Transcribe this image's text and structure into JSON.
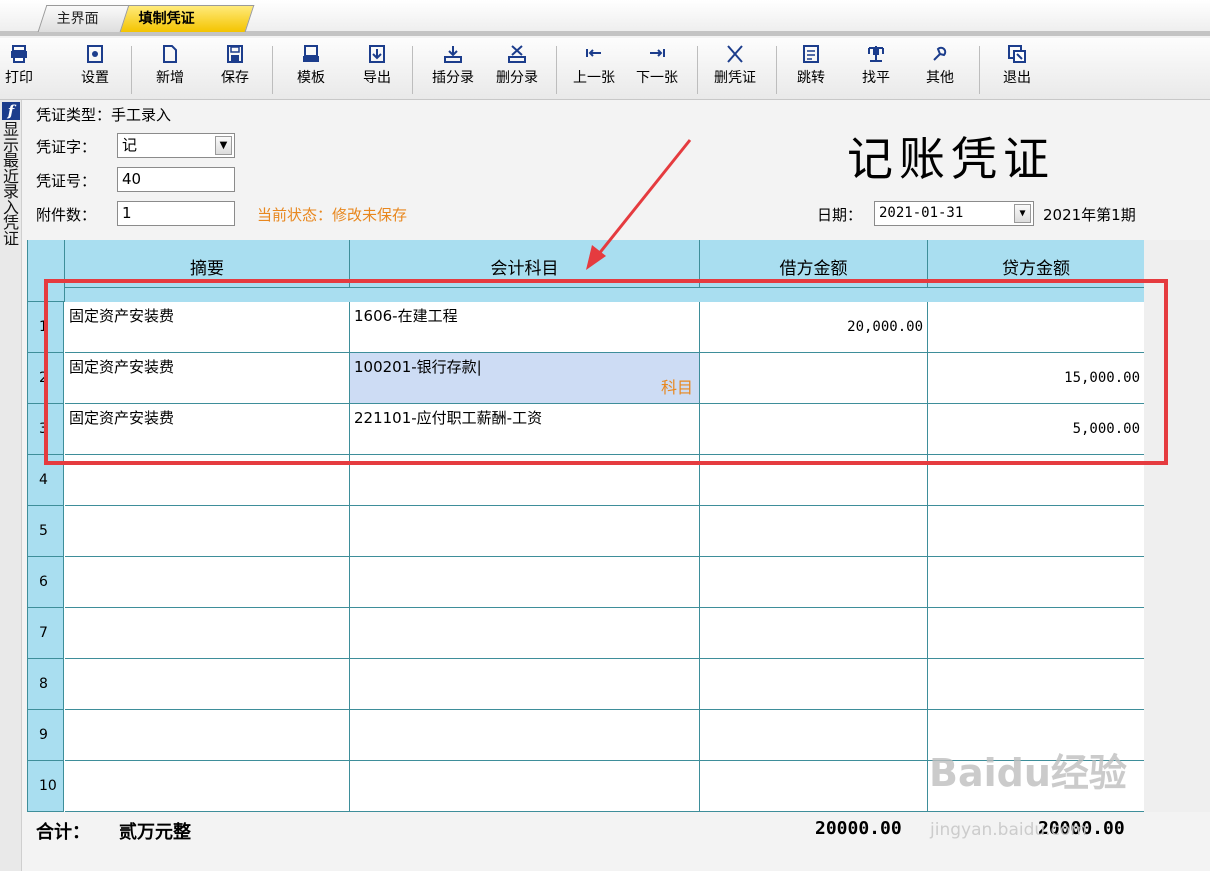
{
  "tabs": [
    {
      "label": "主界面"
    },
    {
      "label": "填制凭证"
    }
  ],
  "toolbar": [
    {
      "label": "打印",
      "icon": "printer-icon"
    },
    {
      "label": "设置",
      "icon": "settings-icon"
    },
    {
      "label": "新增",
      "icon": "new-doc-icon"
    },
    {
      "label": "保存",
      "icon": "save-icon"
    },
    {
      "label": "模板",
      "icon": "template-icon"
    },
    {
      "label": "导出",
      "icon": "export-icon"
    },
    {
      "label": "插分录",
      "icon": "insert-entry-icon"
    },
    {
      "label": "删分录",
      "icon": "delete-entry-icon"
    },
    {
      "label": "上一张",
      "icon": "prev-icon"
    },
    {
      "label": "下一张",
      "icon": "next-icon"
    },
    {
      "label": "删凭证",
      "icon": "delete-voucher-icon"
    },
    {
      "label": "跳转",
      "icon": "jump-icon"
    },
    {
      "label": "找平",
      "icon": "balance-icon"
    },
    {
      "label": "其他",
      "icon": "other-icon"
    },
    {
      "label": "退出",
      "icon": "exit-icon"
    }
  ],
  "side": {
    "icon_letter": "f",
    "text": "显示最近录入凭证"
  },
  "header": {
    "type_label": "凭证类型：",
    "type_value": "手工录入",
    "word_label": "凭证字：",
    "word_value": "记",
    "no_label": "凭证号：",
    "no_value": "40",
    "attach_label": "附件数：",
    "attach_value": "1",
    "status": "当前状态：修改未保存",
    "title": "记账凭证",
    "date_label": "日期：",
    "date_value": "2021-01-31",
    "period": "2021年第1期"
  },
  "grid": {
    "columns": [
      "摘要",
      "会计科目",
      "借方金额",
      "贷方金额"
    ],
    "rows": [
      {
        "no": "1",
        "summary": "固定资产安装费",
        "account": "1606-在建工程",
        "debit": "20,000.00",
        "credit": ""
      },
      {
        "no": "2",
        "summary": "固定资产安装费",
        "account": "100201-银行存款|",
        "debit": "",
        "credit": "15,000.00",
        "hint": "科目"
      },
      {
        "no": "3",
        "summary": "固定资产安装费",
        "account": "221101-应付职工薪酬-工资",
        "debit": "",
        "credit": "5,000.00"
      },
      {
        "no": "4",
        "summary": "",
        "account": "",
        "debit": "",
        "credit": ""
      },
      {
        "no": "5",
        "summary": "",
        "account": "",
        "debit": "",
        "credit": ""
      },
      {
        "no": "6",
        "summary": "",
        "account": "",
        "debit": "",
        "credit": ""
      },
      {
        "no": "7",
        "summary": "",
        "account": "",
        "debit": "",
        "credit": ""
      },
      {
        "no": "8",
        "summary": "",
        "account": "",
        "debit": "",
        "credit": ""
      },
      {
        "no": "9",
        "summary": "",
        "account": "",
        "debit": "",
        "credit": ""
      },
      {
        "no": "10",
        "summary": "",
        "account": "",
        "debit": "",
        "credit": ""
      }
    ]
  },
  "totals": {
    "label": "合计：",
    "words": "贰万元整",
    "debit": "20000.00",
    "credit": "20000.00"
  },
  "watermark": {
    "brand": "Baidu经验",
    "url": "jingyan.baidu.com"
  },
  "colors": {
    "header_bg": "#a9def0",
    "grid_line": "#3e8e9a",
    "status": "#e8871e",
    "highlight": "#e53b3f"
  }
}
